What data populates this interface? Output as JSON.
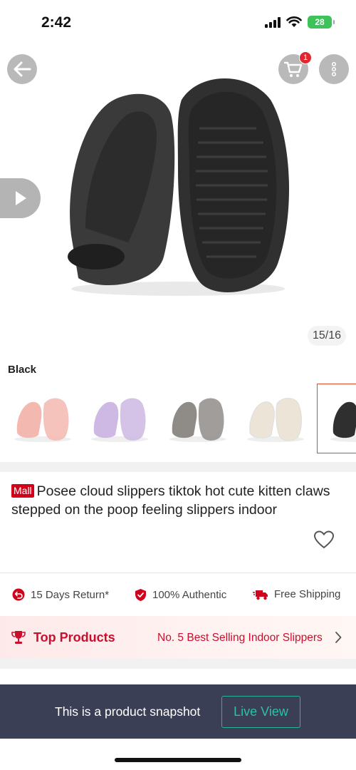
{
  "status_bar": {
    "time": "2:42",
    "battery": "28"
  },
  "header": {
    "cart_count": "1"
  },
  "gallery": {
    "counter": "15/16"
  },
  "variation": {
    "selected_label": "Black",
    "options": [
      {
        "color": "#f3b8b0"
      },
      {
        "color": "#cdb9e3"
      },
      {
        "color": "#8f8c88"
      },
      {
        "color": "#ece4d6"
      },
      {
        "color": "#2f2f2f"
      }
    ]
  },
  "product": {
    "badge": "Mall",
    "title": "Posee cloud slippers tiktok hot  cute kitten claws stepped on the poop feeling slippers indoor"
  },
  "guarantees": {
    "return_label": "15 Days Return*",
    "authentic_label": "100% Authentic",
    "shipping_label": "Free Shipping"
  },
  "top_products": {
    "title": "Top Products",
    "rank_text": "No. 5 Best Selling Indoor Slippers"
  },
  "snapshot": {
    "message": "This is a product snapshot",
    "live_view_label": "Live View"
  },
  "colors": {
    "brand_red": "#d0011b",
    "accent_teal": "#2bc0a9",
    "snapshot_bg": "#3b3f55"
  }
}
